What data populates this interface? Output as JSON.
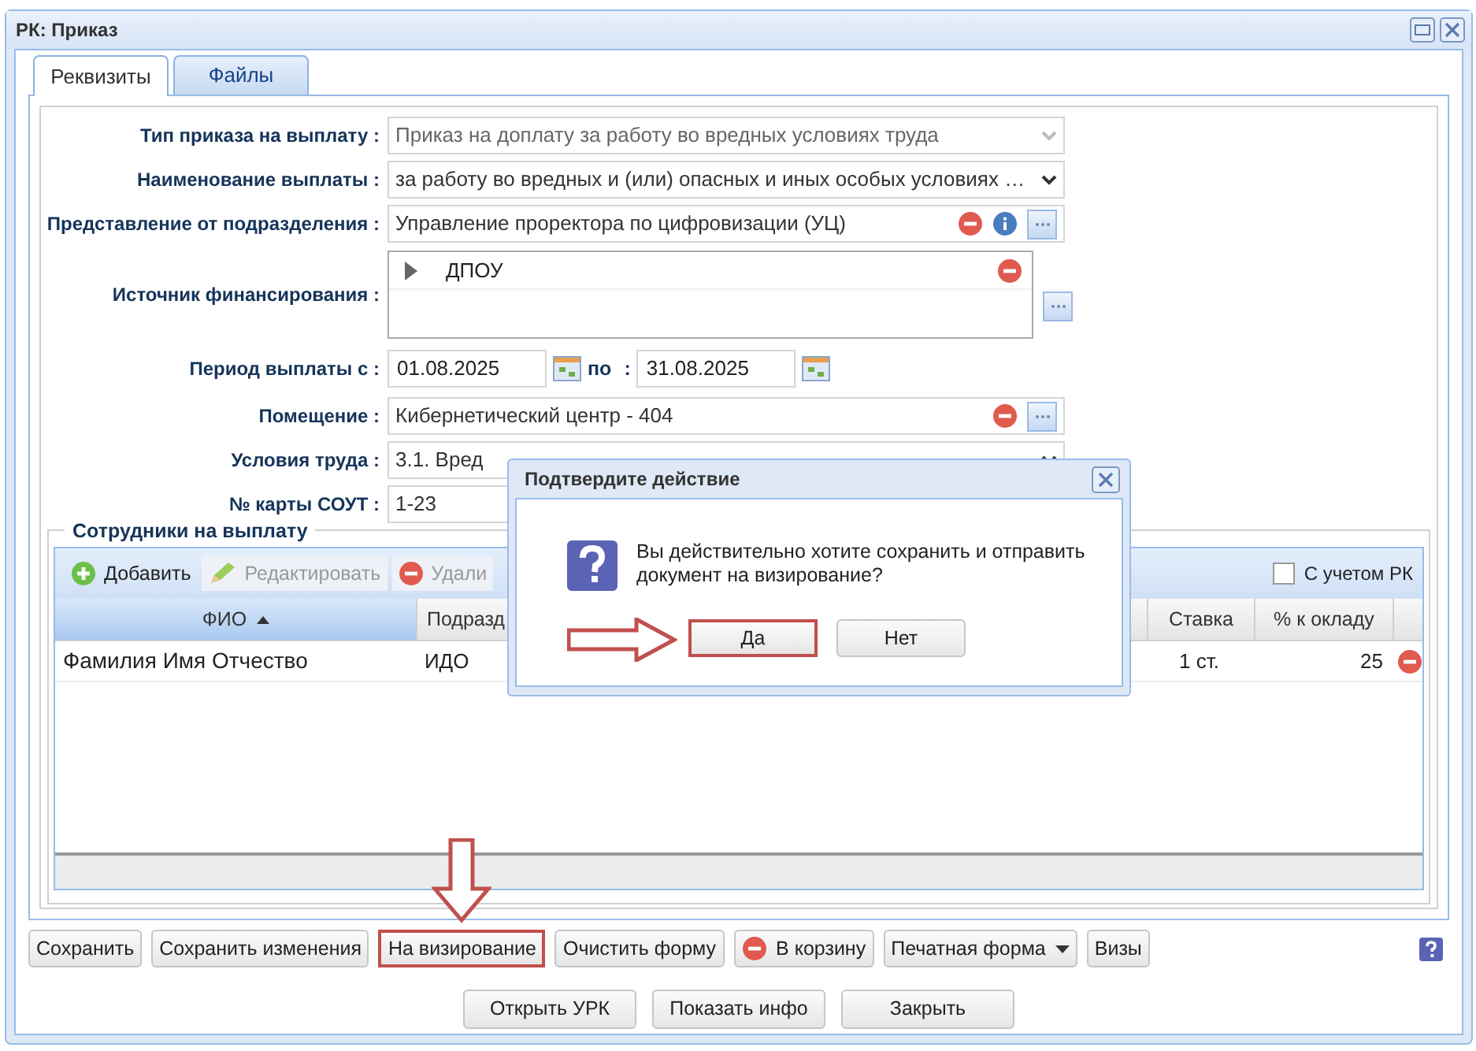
{
  "window": {
    "title": "РК: Приказ"
  },
  "tabs": [
    {
      "label": "Реквизиты",
      "selected": true
    },
    {
      "label": "Файлы",
      "selected": false
    }
  ],
  "form": [
    {
      "kind": "combo",
      "label": "Тип приказа на выплату :",
      "value": "Приказ на доплату за работу во вредных условиях труда",
      "disabled": true
    },
    {
      "kind": "combo",
      "label": "Наименование выплаты :",
      "value": "за работу во вредных и (или) опасных и иных особых условиях …",
      "disabled": false
    },
    {
      "kind": "lookup",
      "label": "Представление от подразделения :",
      "value": "Управление проректора по цифровизации (УЦ)",
      "info": true
    },
    {
      "kind": "list",
      "label": "Источник финансирования :",
      "items": [
        "ДПОУ"
      ]
    },
    {
      "kind": "period",
      "label": "Период выплаты с :",
      "from": "01.08.2025",
      "separator": "по",
      "colon": ":",
      "to": "31.08.2025"
    },
    {
      "kind": "lookup",
      "label": "Помещение :",
      "value": "Кибернетический центр - 404",
      "info": false
    },
    {
      "kind": "combo",
      "label": "Условия труда :",
      "value": "3.1. Вред",
      "disabled": false
    },
    {
      "kind": "text",
      "label": "№ карты СОУТ :",
      "value": "1-23"
    }
  ],
  "employees": {
    "legend": "Сотрудники на выплату",
    "toolbar": [
      {
        "label": "Добавить",
        "disabled": false
      },
      {
        "label": "Редактировать",
        "disabled": true
      },
      {
        "label": "Удали",
        "disabled": true
      }
    ],
    "checkbox": {
      "label": "С учетом РК",
      "checked": false
    },
    "columns": [
      {
        "label": "ФИО",
        "sorted": true
      },
      {
        "label": "Подразд",
        "sorted": false
      },
      {
        "label": "Ставка",
        "sorted": false
      },
      {
        "label": "% к окладу",
        "sorted": false
      }
    ],
    "rows": [
      {
        "cells": [
          "Фамилия Имя Отчество",
          "ИДО",
          "1 ст.",
          "25"
        ]
      }
    ]
  },
  "actions": [
    {
      "label": "Сохранить",
      "highlighted": false
    },
    {
      "label": "Сохранить изменения",
      "highlighted": false
    },
    {
      "label": "На визирование",
      "highlighted": true
    },
    {
      "label": "Очистить форму",
      "highlighted": false
    },
    {
      "label": "В корзину",
      "highlighted": false
    },
    {
      "label": "Печатная форма",
      "menu": true,
      "highlighted": false
    },
    {
      "label": "Визы",
      "highlighted": false
    }
  ],
  "footer_buttons": [
    {
      "label": "Открыть УРК"
    },
    {
      "label": "Показать инфо"
    },
    {
      "label": "Закрыть"
    }
  ],
  "dialog": {
    "title": "Подтвердите действие",
    "message": "Вы действительно хотите сохранить и отправить документ на визирование?",
    "buttons": [
      {
        "label": "Да",
        "highlighted": true
      },
      {
        "label": "Нет",
        "highlighted": false
      }
    ]
  }
}
